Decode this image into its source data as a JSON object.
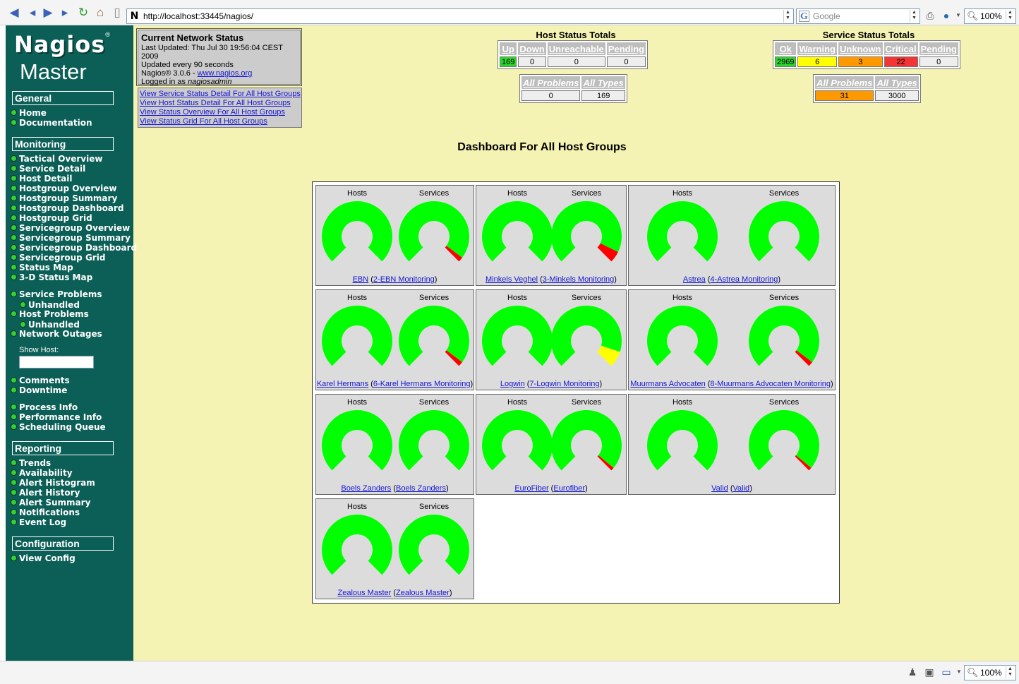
{
  "browser": {
    "url": "http://localhost:33445/nagios/",
    "search_placeholder": "Google",
    "zoom": "100%",
    "status_zoom": "100%"
  },
  "sidebar": {
    "logo": "Nagios",
    "logo_mark": "®",
    "subtitle": "Master",
    "sections": [
      {
        "title": "General",
        "items": [
          "Home",
          "Documentation"
        ]
      },
      {
        "title": "Monitoring",
        "items": [
          "Tactical Overview",
          "Service Detail",
          "Host Detail",
          "Hostgroup Overview",
          "Hostgroup Summary",
          "Hostgroup Dashboard",
          "Hostgroup Grid",
          "Servicegroup Overview",
          "Servicegroup Summary",
          "Servicegroup Dashboard",
          "Servicegroup Grid",
          "Status Map",
          "3-D Status Map"
        ]
      },
      {
        "title": "Reporting",
        "items": [
          "Trends",
          "Availability",
          "Alert Histogram",
          "Alert History",
          "Alert Summary",
          "Notifications",
          "Event Log"
        ]
      },
      {
        "title": "Configuration",
        "items": [
          "View Config"
        ]
      }
    ],
    "problems": [
      "Service Problems",
      "Unhandled",
      "Host Problems",
      "Unhandled",
      "Network Outages"
    ],
    "show_host_label": "Show Host:",
    "extra_items": [
      "Comments",
      "Downtime",
      "Process Info",
      "Performance Info",
      "Scheduling Queue"
    ]
  },
  "status_box": {
    "title": "Current Network Status",
    "last_updated": "Last Updated: Thu Jul 30 19:56:04 CEST 2009",
    "update_interval": "Updated every 90 seconds",
    "version_prefix": "Nagios® 3.0.6 - ",
    "version_link": "www.nagios.org",
    "logged_in_prefix": "Logged in as ",
    "logged_in_user": "nagiosadmin"
  },
  "links": [
    "View Service Status Detail For All Host Groups",
    "View Host Status Detail For All Host Groups",
    "View Status Overview For All Host Groups",
    "View Status Grid For All Host Groups"
  ],
  "host_totals": {
    "title": "Host Status Totals",
    "headers": [
      "Up",
      "Down",
      "Unreachable",
      "Pending"
    ],
    "values": [
      "169",
      "0",
      "0",
      "0"
    ],
    "sum_headers": [
      "All Problems",
      "All Types"
    ],
    "sum_values": [
      "0",
      "169"
    ]
  },
  "service_totals": {
    "title": "Service Status Totals",
    "headers": [
      "Ok",
      "Warning",
      "Unknown",
      "Critical",
      "Pending"
    ],
    "values": [
      "2969",
      "6",
      "3",
      "22",
      "0"
    ],
    "sum_headers": [
      "All Problems",
      "All Types"
    ],
    "sum_values": [
      "31",
      "3000"
    ]
  },
  "colors": {
    "up": "#2ed52e",
    "ok": "#2ed52e",
    "warning": "#ffff00",
    "unknown": "#ff9900",
    "critical": "#f33535",
    "all_problems_service": "#ff9900",
    "gauge_ok": "#00ff00",
    "gauge_crit": "#ff0000",
    "gauge_warn": "#ffff00"
  },
  "dashboard": {
    "title": "Dashboard For All Host Groups",
    "hosts_label": "Hosts",
    "services_label": "Services",
    "groups": [
      {
        "name": "EBN",
        "alias": "2-EBN Monitoring",
        "host_bad": 0,
        "svc_bad": 0.03,
        "svc_color": "crit"
      },
      {
        "name": "Minkels Veghel",
        "alias": "3-Minkels Monitoring",
        "host_bad": 0,
        "svc_bad": 0.07,
        "svc_color": "crit"
      },
      {
        "name": "Astrea",
        "alias": "4-Astrea Monitoring",
        "host_bad": 0,
        "svc_bad": 0,
        "svc_color": "crit"
      },
      {
        "name": "Karel Hermans",
        "alias": "6-Karel Hermans Monitoring",
        "host_bad": 0,
        "svc_bad": 0.03,
        "svc_color": "crit"
      },
      {
        "name": "Logwin",
        "alias": "7-Logwin Monitoring",
        "host_bad": 0,
        "svc_bad": 0.1,
        "svc_color": "warn"
      },
      {
        "name": "Muurmans Advocaten",
        "alias": "8-Muurmans Advocaten Monitoring",
        "host_bad": 0,
        "svc_bad": 0.03,
        "svc_color": "crit"
      },
      {
        "name": "Boels Zanders",
        "alias": "Boels Zanders",
        "host_bad": 0,
        "svc_bad": 0,
        "svc_color": "crit"
      },
      {
        "name": "EuroFiber",
        "alias": "Eurofiber",
        "host_bad": 0,
        "svc_bad": 0.02,
        "svc_color": "crit"
      },
      {
        "name": "Valid",
        "alias": "Valid",
        "host_bad": 0,
        "svc_bad": 0.02,
        "svc_color": "crit"
      },
      {
        "name": "Zealous Master",
        "alias": "Zealous Master",
        "host_bad": 0,
        "svc_bad": 0,
        "svc_color": "crit"
      }
    ]
  }
}
